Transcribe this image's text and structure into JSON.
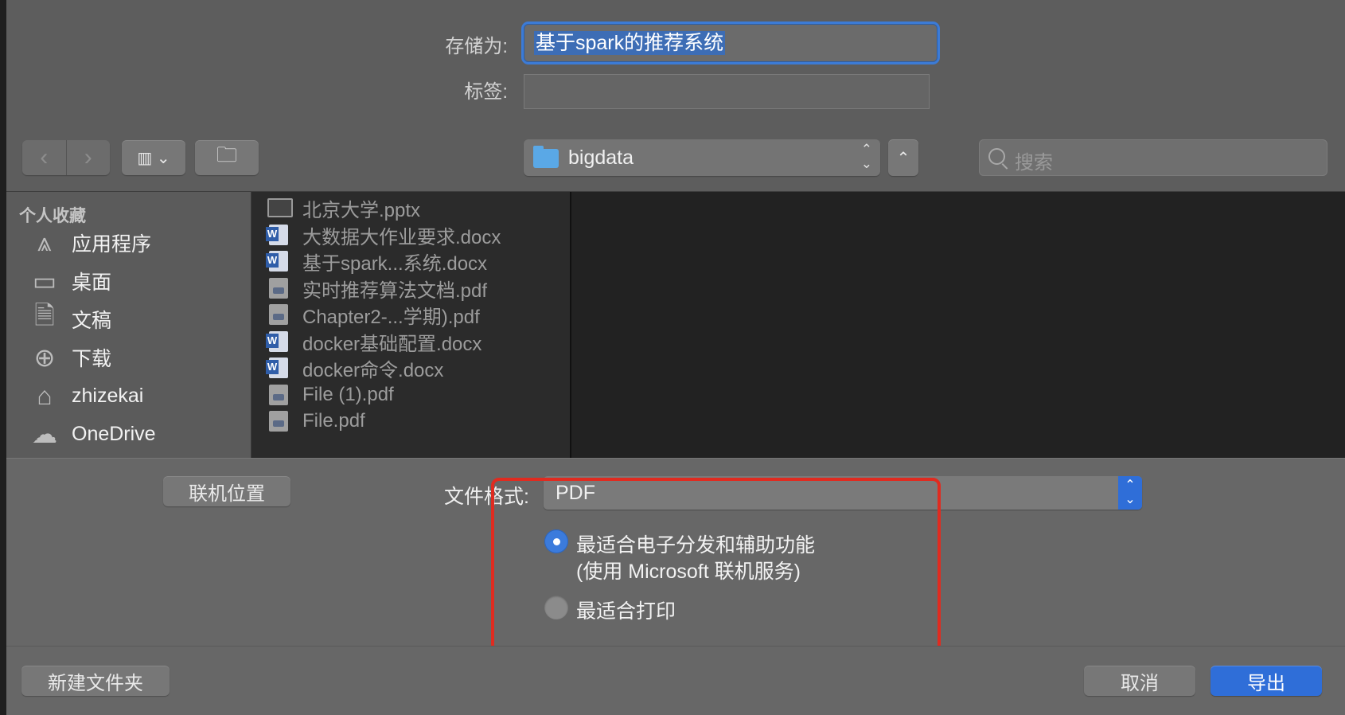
{
  "form": {
    "save_as_label": "存储为:",
    "filename": "基于spark的推荐系统",
    "tags_label": "标签:",
    "tags_value": ""
  },
  "toolbar": {
    "back_icon": "chevron-left-icon",
    "forward_icon": "chevron-right-icon",
    "view_icon": "column-view-icon",
    "new_folder_icon": "new-folder-icon",
    "location": "bigdata",
    "search_placeholder": "搜索"
  },
  "sidebar": {
    "header": "个人收藏",
    "items": [
      {
        "label": "应用程序",
        "icon": "applications-icon"
      },
      {
        "label": "桌面",
        "icon": "desktop-icon"
      },
      {
        "label": "文稿",
        "icon": "documents-icon"
      },
      {
        "label": "下载",
        "icon": "downloads-icon"
      },
      {
        "label": "zhizekai",
        "icon": "home-icon"
      },
      {
        "label": "OneDrive",
        "icon": "cloud-icon"
      }
    ]
  },
  "files": [
    {
      "name": "北京大学.pptx",
      "type": "pptx"
    },
    {
      "name": "大数据大作业要求.docx",
      "type": "docx"
    },
    {
      "name": "基于spark...系统.docx",
      "type": "docx"
    },
    {
      "name": "实时推荐算法文档.pdf",
      "type": "pdf"
    },
    {
      "name": "Chapter2-...学期).pdf",
      "type": "pdf"
    },
    {
      "name": "docker基础配置.docx",
      "type": "docx"
    },
    {
      "name": "docker命令.docx",
      "type": "docx"
    },
    {
      "name": "File (1).pdf",
      "type": "pdf"
    },
    {
      "name": "File.pdf",
      "type": "pdf"
    }
  ],
  "options": {
    "online_location_button": "联机位置",
    "format_label": "文件格式:",
    "format_value": "PDF",
    "radio_electronic_line1": "最适合电子分发和辅助功能",
    "radio_electronic_line2": "(使用 Microsoft 联机服务)",
    "radio_print": "最适合打印",
    "selected": "electronic"
  },
  "footer": {
    "new_folder": "新建文件夹",
    "cancel": "取消",
    "export": "导出"
  },
  "colors": {
    "accent": "#2f6ed8",
    "highlight_border": "#e02b20"
  }
}
